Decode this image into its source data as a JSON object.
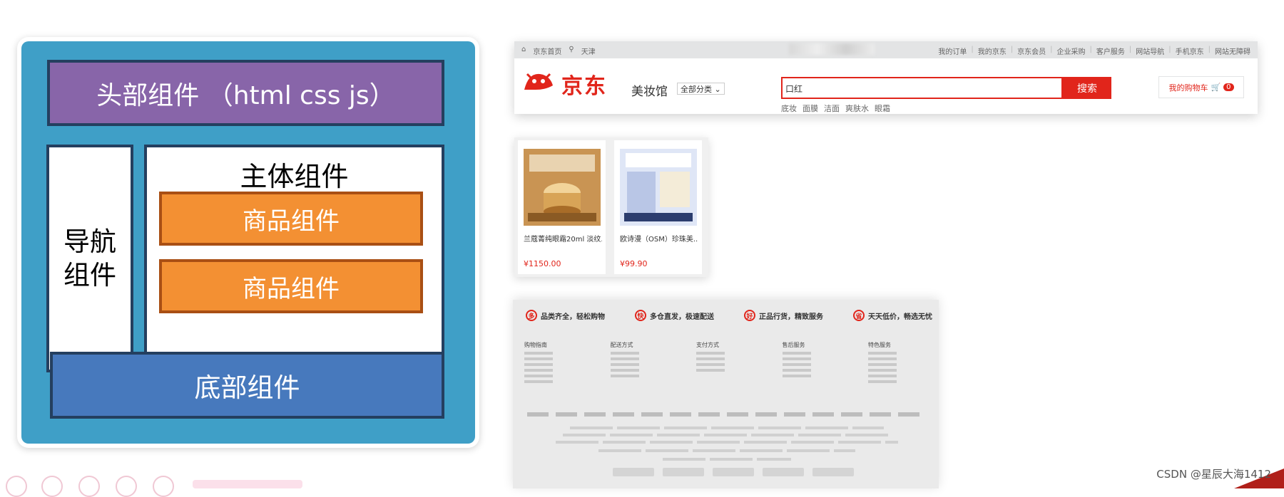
{
  "diagram": {
    "header": "头部组件 （html css js）",
    "nav": "导航\n组件",
    "main_title": "主体组件",
    "product_1": "商品组件",
    "product_2": "商品组件",
    "footer": "底部组件"
  },
  "jd_header": {
    "topbar_left": [
      "京东首页",
      "天津"
    ],
    "topbar_links": [
      "我的订单",
      "我的京东",
      "京东会员",
      "企业采购",
      "客户服务",
      "网站导航",
      "手机京东",
      "网站无障碍"
    ],
    "logo": "京东",
    "channel": "美妆馆",
    "category_button": "全部分类",
    "search_value": "口红",
    "search_button": "搜索",
    "hot_words": [
      "底妆",
      "面膜",
      "洁面",
      "爽肤水",
      "眼霜"
    ],
    "cart_label": "我的购物车",
    "cart_count": "0"
  },
  "products": [
    {
      "name": "兰蔻菁纯眼霜20ml 淡纹...",
      "price": "¥1150.00",
      "color": "#b8823a"
    },
    {
      "name": "欧诗漫（OSM）珍珠美...",
      "price": "¥99.90",
      "color": "#b9c6e6"
    }
  ],
  "jd_footer": {
    "slogans": [
      {
        "icon": "多",
        "text": "品类齐全，轻松购物"
      },
      {
        "icon": "快",
        "text": "多仓直发，极速配送"
      },
      {
        "icon": "好",
        "text": "正品行货，精致服务"
      },
      {
        "icon": "省",
        "text": "天天低价，畅选无忧"
      }
    ],
    "columns": [
      "购物指南",
      "配送方式",
      "支付方式",
      "售后服务",
      "特色服务"
    ]
  },
  "watermark": "CSDN @星辰大海1412",
  "colors": {
    "diagram_bg": "#3f9fc7",
    "header_block": "#8865a9",
    "product_block": "#f39033",
    "footer_block": "#4779bd",
    "jd_red": "#e1251b"
  }
}
